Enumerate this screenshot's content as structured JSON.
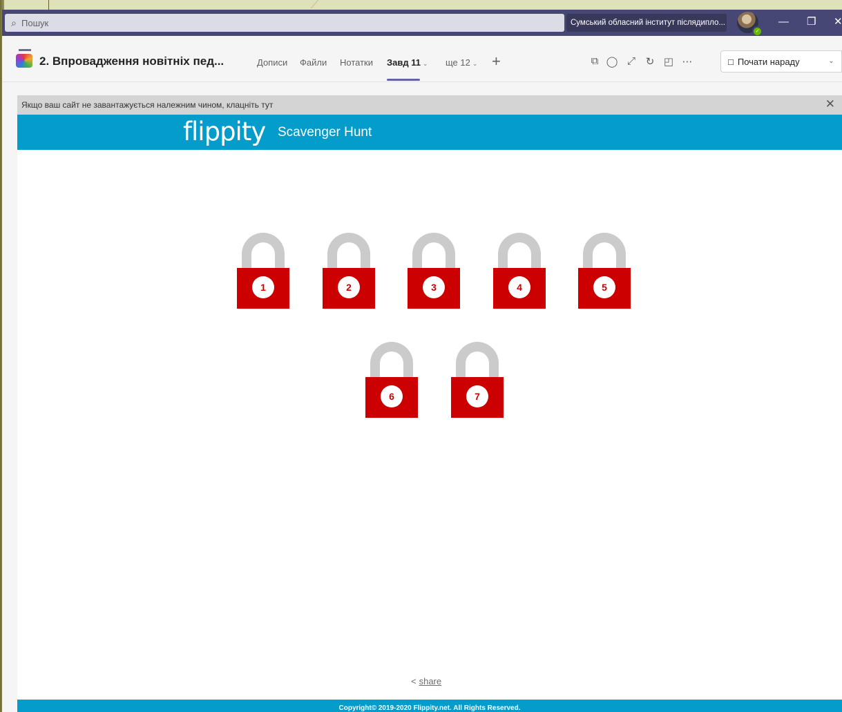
{
  "titlebar": {
    "search_placeholder": "Пошук",
    "org_name": "Сумський обласний інститут післядипло...",
    "window_controls": [
      "minimize-icon",
      "restore-icon",
      "close-icon"
    ]
  },
  "channel": {
    "title": "2. Впровадження новітніх пед...",
    "tabs": [
      {
        "label": "Дописи"
      },
      {
        "label": "Файли"
      },
      {
        "label": "Нотатки"
      },
      {
        "label": "Завд 11",
        "active": true
      },
      {
        "label": "ще 12"
      }
    ],
    "tools": [
      "popout-icon",
      "chat-icon",
      "expand-icon",
      "refresh-icon",
      "globe-icon",
      "more-icon"
    ],
    "meet_button": "Почати нараду"
  },
  "notice": {
    "text": "Якщо ваш сайт не завантажується належним чином, клацніть тут"
  },
  "flippity": {
    "logo": "flippity",
    "title": "Scavenger Hunt",
    "locks": [
      "1",
      "2",
      "3",
      "4",
      "5",
      "6",
      "7"
    ],
    "share_label": "share",
    "footer": "Copyright© 2019-2020 Flippity.net. All Rights Reserved."
  },
  "colors": {
    "teams_titlebar": "#464775",
    "flippity_blue": "#039ccb",
    "lock_red": "#cc0000",
    "shackle_grey": "#cbcbcb",
    "tab_accent": "#6264a7"
  }
}
